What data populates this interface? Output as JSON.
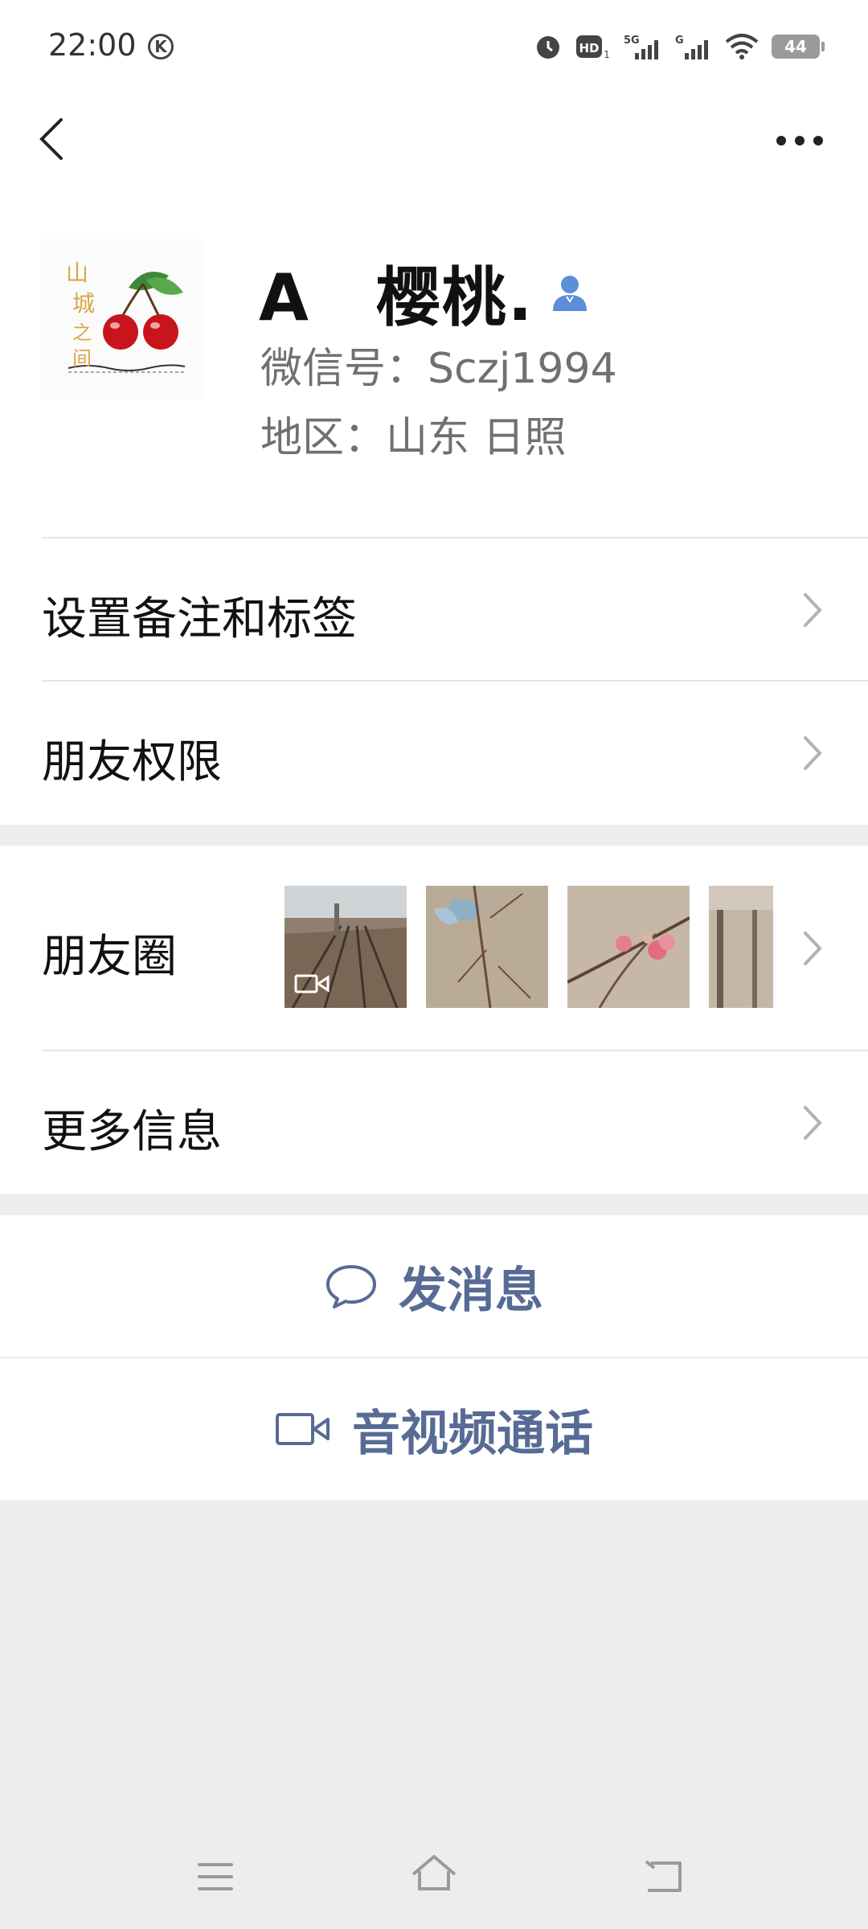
{
  "status_bar": {
    "time": "22:00",
    "k_badge": "K",
    "battery": "44",
    "icons": [
      "alarm-icon",
      "hd-icon",
      "5g-signal-icon",
      "g-signal-icon",
      "wifi-icon",
      "battery-icon"
    ]
  },
  "nav": {
    "back_icon": "chevron-left-icon",
    "more_icon": "more-dots-icon"
  },
  "profile": {
    "name": "A　樱桃.",
    "wechat_id": "微信号：Sczj1994",
    "region": "地区：山东  日照",
    "avatar_icon": "cherry-logo-avatar",
    "avatar_text_lines": [
      "山",
      "城",
      "之",
      "间"
    ]
  },
  "menu": {
    "set_remark": "设置备注和标签",
    "friend_permissions": "朋友权限",
    "moments": "朋友圈",
    "more_info": "更多信息"
  },
  "actions": {
    "message": "发消息",
    "call": "音视频通话"
  },
  "colors": {
    "link_blue": "#576b95",
    "background": "#ededed",
    "person_icon": "#5b8fd8"
  }
}
